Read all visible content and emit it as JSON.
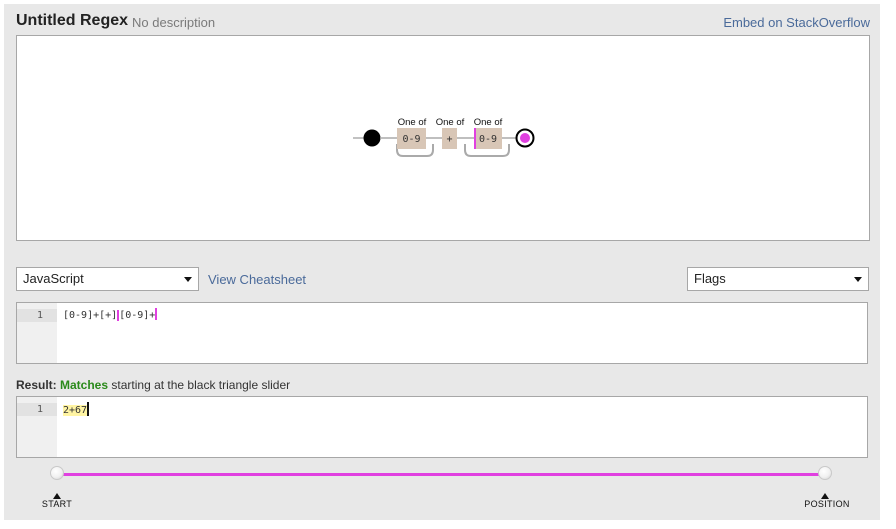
{
  "header": {
    "title": "Untitled Regex",
    "description": "No description",
    "embed_link": "Embed on StackOverflow"
  },
  "diagram": {
    "groups": [
      {
        "label": "One of",
        "token": "0-9"
      },
      {
        "label": "One of",
        "token": "+"
      },
      {
        "label": "One of",
        "token": "0-9"
      }
    ],
    "start_icon": "start-node-icon",
    "end_icon": "end-node-icon",
    "colors": {
      "accent": "#e040e0",
      "token_bg": "#d8c6b6",
      "loop": "#aaaaaa"
    }
  },
  "controls": {
    "flavor": "JavaScript",
    "cheatsheet_link": "View Cheatsheet",
    "flags": "Flags"
  },
  "regex_editor": {
    "line_number": "1",
    "parts": [
      "[0-9]+[+]",
      "[0-9]+"
    ]
  },
  "result": {
    "label": "Result:",
    "status": "Matches",
    "message": "starting at the black triangle slider",
    "status_color": "#2a8a1a"
  },
  "test_editor": {
    "line_number": "1",
    "text": "2+67"
  },
  "slider": {
    "start_label": "START",
    "end_label": "POSITION",
    "track_color": "#e040e0",
    "start_position": 0,
    "end_position": 1
  }
}
